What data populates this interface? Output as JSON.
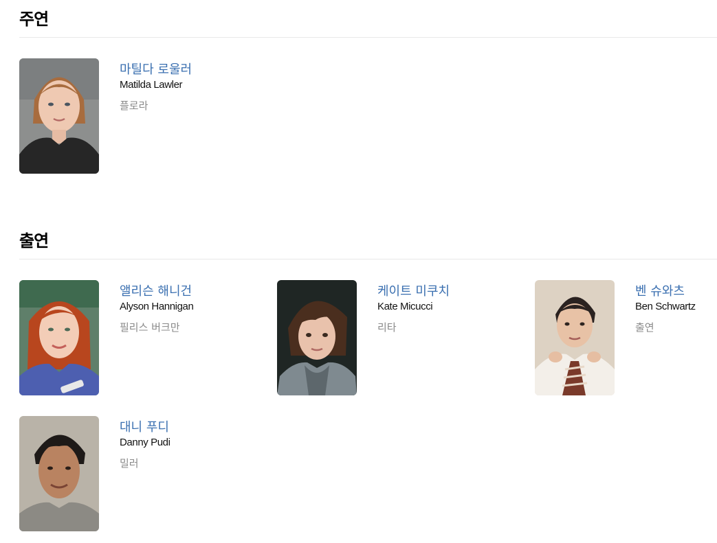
{
  "main_cast": {
    "title": "주연",
    "people": [
      {
        "name_ko": "마틸다 로울러",
        "name_en": "Matilda Lawler",
        "role": "플로라",
        "photo_icon": "portrait-photo"
      }
    ]
  },
  "supporting_cast": {
    "title": "출연",
    "people": [
      {
        "name_ko": "앨리슨 해니건",
        "name_en": "Alyson Hannigan",
        "role": "필리스 버크만",
        "photo_icon": "portrait-photo"
      },
      {
        "name_ko": "케이트 미쿠치",
        "name_en": "Kate Micucci",
        "role": "리타",
        "photo_icon": "portrait-photo"
      },
      {
        "name_ko": "벤 슈와츠",
        "name_en": "Ben Schwartz",
        "role": "출연",
        "photo_icon": "portrait-photo"
      },
      {
        "name_ko": "대니 푸디",
        "name_en": "Danny Pudi",
        "role": "밀러",
        "photo_icon": "portrait-photo"
      }
    ]
  },
  "colors": {
    "link": "#3a6fb0",
    "role_text": "#8a8a8a",
    "divider": "#e8e8e8"
  }
}
